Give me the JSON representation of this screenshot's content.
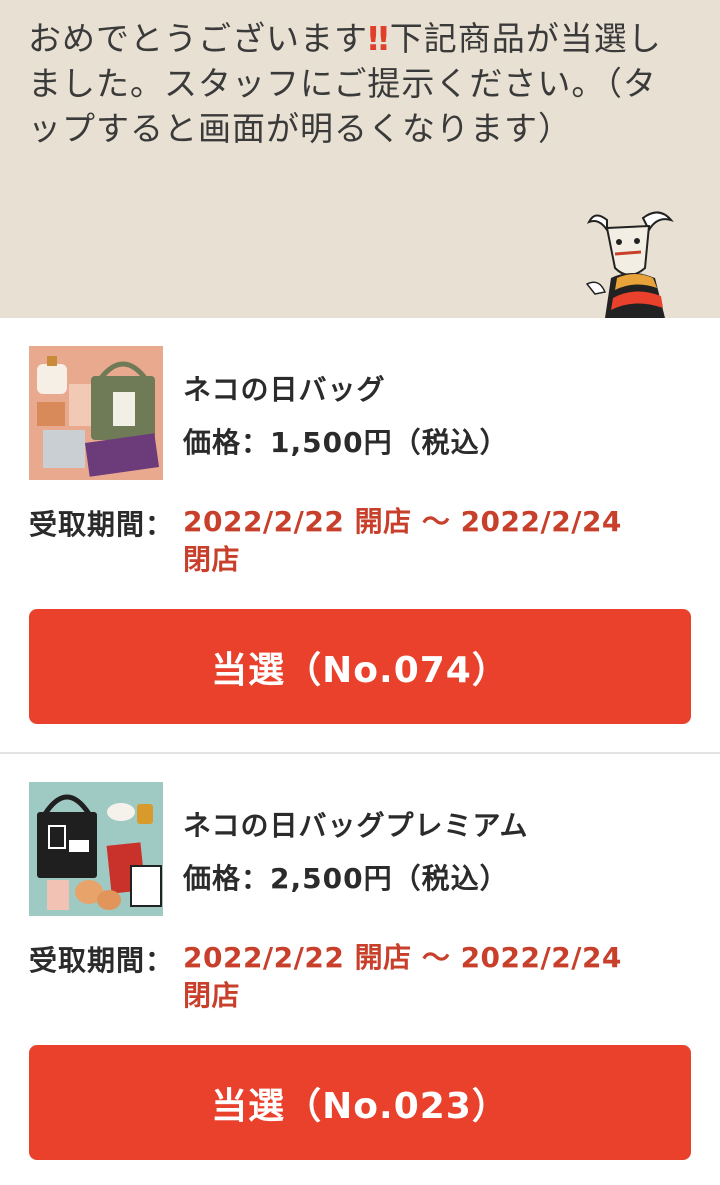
{
  "banner": {
    "message_part1": "おめでとうございます",
    "exclamation": "‼",
    "message_part2": "下記商品が当選しました。スタッフにご提示ください。（タップすると画面が明るくなります）"
  },
  "products": [
    {
      "name": "ネコの日バッグ",
      "price_label": "価格：",
      "price": "1,500円（税込）",
      "period_label": "受取期間：",
      "period": "2022/2/22 開店 〜 2022/2/24 閉店",
      "button_label": "当選（No.074）"
    },
    {
      "name": "ネコの日バッグプレミアム",
      "price_label": "価格：",
      "price": "2,500円（税込）",
      "period_label": "受取期間：",
      "period": "2022/2/22 開店 〜 2022/2/24 閉店",
      "button_label": "当選（No.023）"
    }
  ],
  "colors": {
    "banner_bg": "#e8e1d3",
    "accent_red": "#e9412b",
    "period_red": "#c8402b"
  }
}
